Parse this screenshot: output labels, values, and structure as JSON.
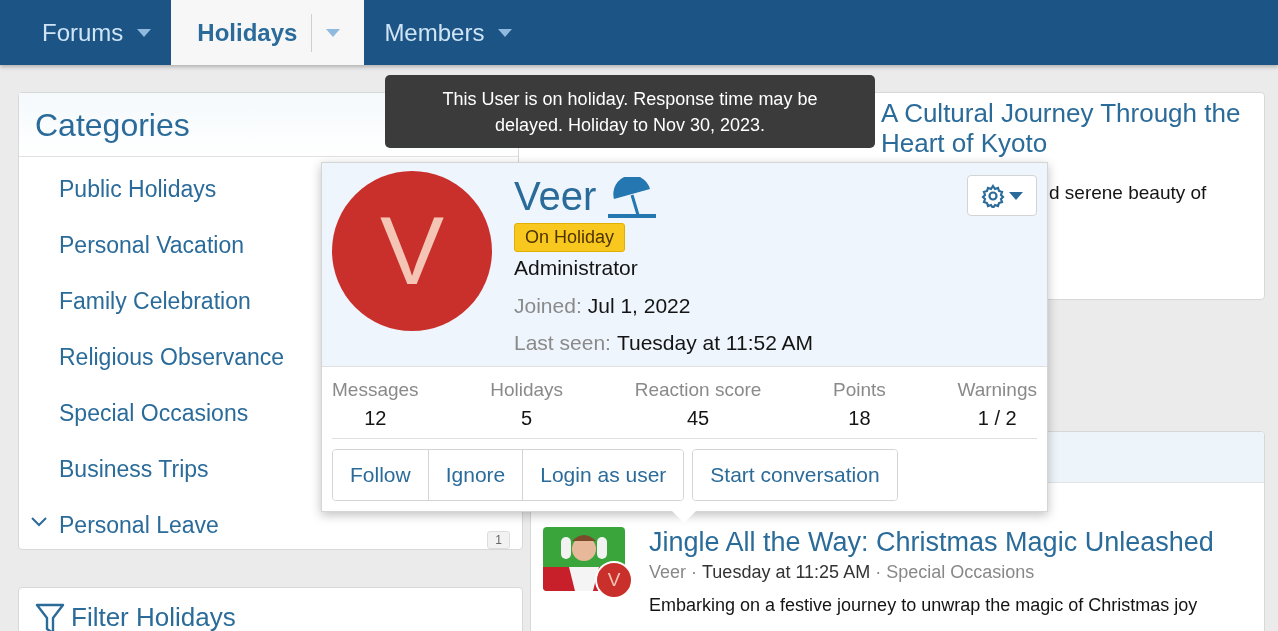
{
  "nav": {
    "tabs": [
      {
        "label": "Forums",
        "selected": false
      },
      {
        "label": "Holidays",
        "selected": true
      },
      {
        "label": "Members",
        "selected": false
      }
    ]
  },
  "sidebar": {
    "title": "Categories",
    "items": [
      {
        "label": "Public Holidays"
      },
      {
        "label": "Personal Vacation"
      },
      {
        "label": "Family Celebration"
      },
      {
        "label": "Religious Observance"
      },
      {
        "label": "Special Occasions"
      },
      {
        "label": "Business Trips"
      },
      {
        "label": "Personal Leave",
        "expanded": true,
        "count": "1"
      }
    ]
  },
  "filter": {
    "title": "Filter Holidays"
  },
  "articles": [
    {
      "title": "A Cultural Journey Through the Heart of Kyoto",
      "excerpt": "d serene beauty of"
    },
    {
      "title": "Jingle All the Way: Christmas Magic Unleashed",
      "author": "Veer",
      "separator": "·",
      "date": "Tuesday at 11:25 AM",
      "category": "Special Occasions",
      "avatar_initial": "V",
      "excerpt": "Embarking on a festive journey to unwrap the magic of Christmas joy"
    }
  ],
  "tooltip": {
    "text": "This User is on holiday. Response time may be delayed. Holiday to Nov 30, 2023."
  },
  "profile_card": {
    "initial": "V",
    "name": "Veer",
    "badge": "On Holiday",
    "role": "Administrator",
    "details": [
      {
        "label": "Joined:",
        "value": "Jul 1, 2022"
      },
      {
        "label": "Last seen:",
        "value": "Tuesday at 11:52 AM"
      }
    ],
    "stats": [
      {
        "label": "Messages",
        "value": "12"
      },
      {
        "label": "Holidays",
        "value": "5"
      },
      {
        "label": "Reaction score",
        "value": "45"
      },
      {
        "label": "Points",
        "value": "18"
      },
      {
        "label": "Warnings",
        "value": "1 / 2"
      }
    ],
    "action_groups": [
      {
        "buttons": [
          "Follow",
          "Ignore",
          "Login as user"
        ]
      },
      {
        "buttons": [
          "Start conversation"
        ]
      }
    ]
  }
}
